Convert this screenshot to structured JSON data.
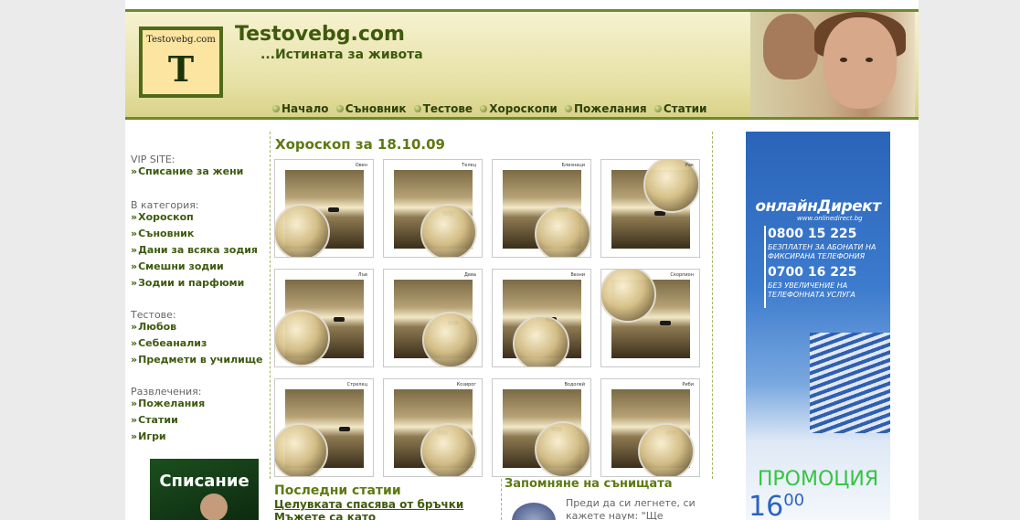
{
  "header": {
    "logo_text": "Testovebg.com",
    "logo_letter": "T",
    "site_title": "Testovebg.com",
    "slogan": "...Истината за живота",
    "nav": [
      "Начало",
      "Съновник",
      "Тестове",
      "Хороскопи",
      "Пожелания",
      "Статии"
    ]
  },
  "sidebar": {
    "groups": [
      {
        "heading": "VIP SITE:",
        "items": [
          "Списание за жени"
        ]
      },
      {
        "heading": "В категория:",
        "items": [
          "Хороскоп",
          "Съновник",
          "Дани за всяка зодия",
          "Смешни зодии",
          "Зодии и парфюми"
        ]
      },
      {
        "heading": "Тестове:",
        "items": [
          "Любов",
          "Себеанализ",
          "Предмети в училище"
        ]
      },
      {
        "heading": "Развлечения:",
        "items": [
          "Пожелания",
          "Статии",
          "Игри"
        ]
      }
    ],
    "banner_text": "Списание"
  },
  "horoscope": {
    "title": "Хороскоп за 18.10.09",
    "tiles": [
      "Овен",
      "Телец",
      "Близнаци",
      "Рак",
      "Лъв",
      "Дева",
      "Везни",
      "Скорпион",
      "Стрелец",
      "Козирог",
      "Водолей",
      "Риби"
    ]
  },
  "recent": {
    "title": "Последни статии",
    "articles": [
      "Целувката спасява от бръчки",
      "Мъжете са като"
    ]
  },
  "dream": {
    "title": "Запомняне на сънищата",
    "text": "Преди да си легнете, си кажете наум: \"Ще"
  },
  "ad": {
    "brand": "онлайнДирект",
    "url": "www.onlinedirect.bg",
    "phone1": "0800 15 225",
    "phone1_text": "БЕЗПЛАТЕН ЗА АБОНАТИ НА ФИКСИРАНА ТЕЛЕФОНИЯ",
    "phone2": "0700 16 225",
    "phone2_text": "БЕЗ УВЕЛИЧЕНИЕ НА ТЕЛЕФОННАТА УСЛУГА",
    "promo": "ПРОМОЦИЯ",
    "price_main": "16",
    "price_cents": "00"
  },
  "colors": {
    "accent": "#6a8a2e",
    "link": "#3d5a0d",
    "heading": "#5d7a10"
  }
}
